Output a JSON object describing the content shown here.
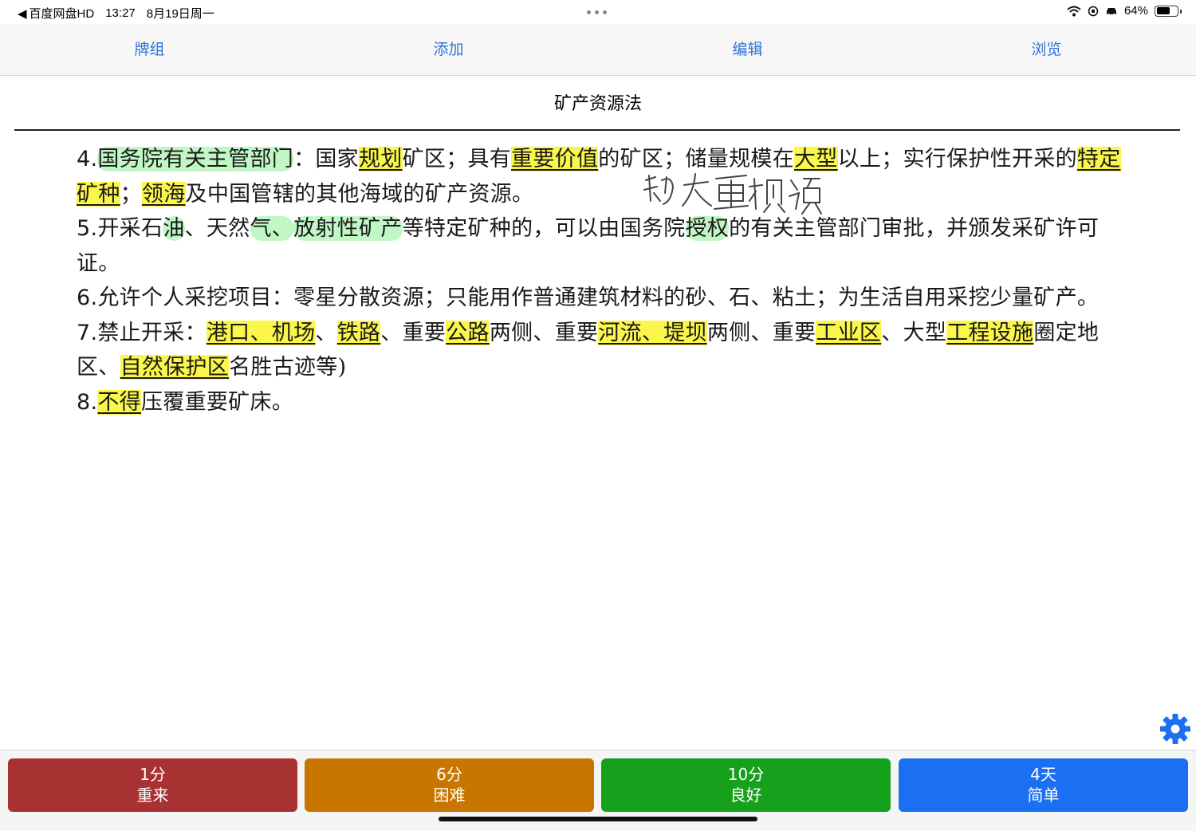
{
  "status_bar": {
    "back_app": "百度网盘HD",
    "time": "13:27",
    "date": "8月19日周一",
    "battery": "64%",
    "battery_level": 0.64
  },
  "top_tabs": [
    "牌组",
    "添加",
    "编辑",
    "浏览"
  ],
  "card": {
    "title": "矿产资源法",
    "lines": [
      [
        {
          "t": "4.",
          "s": "num"
        },
        {
          "t": "国务院有关主管部门",
          "s": "g"
        },
        {
          "t": "：国家"
        },
        {
          "t": "规划",
          "s": "y"
        },
        {
          "t": "矿区；具有"
        },
        {
          "t": "重要价值",
          "s": "y"
        },
        {
          "t": "的矿区；储量规模在"
        },
        {
          "t": "大型",
          "s": "y"
        },
        {
          "t": "以上；实行保护性开采的"
        },
        {
          "t": "特定矿种",
          "s": "y"
        },
        {
          "t": "；"
        },
        {
          "t": "领海",
          "s": "y"
        },
        {
          "t": "及中国管辖的其他海域的矿产资源。"
        }
      ],
      [
        {
          "t": "5.",
          "s": "num"
        },
        {
          "t": "开采石"
        },
        {
          "t": "油",
          "s": "g"
        },
        {
          "t": "、天然"
        },
        {
          "t": "气、",
          "s": "g"
        },
        {
          "t": "放射性矿产",
          "s": "g"
        },
        {
          "t": "等特定矿种的，可以由国务院"
        },
        {
          "t": "授权",
          "s": "g"
        },
        {
          "t": "的有关主管部门审批，并颁发采矿许可证。"
        }
      ],
      [
        {
          "t": "6.",
          "s": "num"
        },
        {
          "t": "允许个人采挖项目：零星分散资源；只能用作普通建筑材料的砂、石、粘土；为生活自用采挖少量矿产。"
        }
      ],
      [
        {
          "t": "7.",
          "s": "num"
        },
        {
          "t": "禁止开采："
        },
        {
          "t": "港口、机场",
          "s": "y"
        },
        {
          "t": "、"
        },
        {
          "t": "铁路",
          "s": "y"
        },
        {
          "t": "、重要"
        },
        {
          "t": "公路",
          "s": "y"
        },
        {
          "t": "两侧、重要"
        },
        {
          "t": "河流、堤坝",
          "s": "y"
        },
        {
          "t": "两侧、重要"
        },
        {
          "t": "工业区",
          "s": "y"
        },
        {
          "t": "、大型"
        },
        {
          "t": "工程设施",
          "s": "y"
        },
        {
          "t": "圈定地区、"
        },
        {
          "t": "自然保护区",
          "s": "y"
        },
        {
          "t": "名胜古迹等)"
        }
      ],
      [
        {
          "t": "8.",
          "s": "num"
        },
        {
          "t": "不得",
          "s": "y"
        },
        {
          "t": "压覆重要矿床。"
        }
      ]
    ],
    "handwritten_note": "特大重规领"
  },
  "settings_icon": "gear-icon",
  "answer_buttons": [
    {
      "interval": "1分",
      "label": "重来",
      "color": "#a83232"
    },
    {
      "interval": "6分",
      "label": "困难",
      "color": "#c97600"
    },
    {
      "interval": "10分",
      "label": "良好",
      "color": "#15a11b"
    },
    {
      "interval": "4天",
      "label": "简单",
      "color": "#1a6ff2"
    }
  ]
}
